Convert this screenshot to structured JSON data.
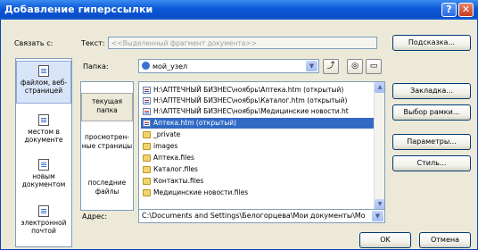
{
  "window": {
    "title": "Добавление гиперссылки"
  },
  "link_to": {
    "label": "Связать с:",
    "items": [
      {
        "label": "файлом, веб-страницей"
      },
      {
        "label": "местом в документе"
      },
      {
        "label": "новым документом"
      },
      {
        "label": "электронной почтой"
      }
    ]
  },
  "text_field": {
    "label": "Текст:",
    "value": "<<Выделенный фрагмент документа>>"
  },
  "folder": {
    "label": "Папка:",
    "value": "мой_узел"
  },
  "subnav": {
    "items": [
      {
        "label": "текущая папка"
      },
      {
        "label": "просмотрен-ные страницы"
      },
      {
        "label": "последние файлы"
      }
    ]
  },
  "files": [
    {
      "name": "H:\\АПТЕЧНЫЙ БИЗНЕС\\ноябрь\\Аптека.htm (открытый)",
      "type": "doc"
    },
    {
      "name": "H:\\АПТЕЧНЫЙ БИЗНЕС\\ноябрь\\Каталог.htm (открытый)",
      "type": "doc"
    },
    {
      "name": "H:\\АПТЕЧНЫЙ БИЗНЕС\\ноябрь\\Медицинские новости.ht",
      "type": "doc"
    },
    {
      "name": "Аптека.htm (открытый)",
      "type": "doc",
      "selected": true
    },
    {
      "name": "_private",
      "type": "folder"
    },
    {
      "name": "images",
      "type": "folder"
    },
    {
      "name": "Аптека.files",
      "type": "folder"
    },
    {
      "name": "Каталог.files",
      "type": "folder"
    },
    {
      "name": "Контакты.files",
      "type": "folder"
    },
    {
      "name": "Медицинские новости.files",
      "type": "folder"
    }
  ],
  "address": {
    "label": "Адрес:",
    "value": "C:\\Documents and Settings\\Белогорцева\\Мои документы\\Мо"
  },
  "buttons": {
    "hint": "Подсказка...",
    "bookmark": "Закладка...",
    "frame": "Выбор рамки...",
    "params": "Параметры...",
    "style": "Стиль...",
    "ok": "OK",
    "cancel": "Отмена"
  },
  "colors": {
    "title_bar": "#0b4fc8",
    "selection": "#316ac5",
    "dialog_bg": "#ece9d8"
  }
}
